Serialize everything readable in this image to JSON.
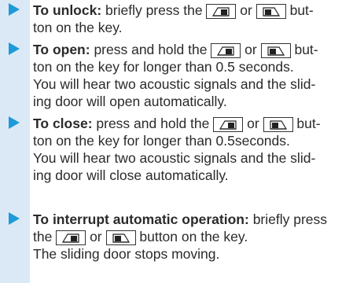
{
  "items": [
    {
      "lead": "To unlock:",
      "l1_a": " briefly press the ",
      "l1_mid": " or ",
      "l1_b": " but-",
      "l2": "ton on the key."
    },
    {
      "lead": "To open:",
      "l1_a": " press and hold the ",
      "l1_mid": " or ",
      "l1_b": " but-",
      "l2": "ton on the key for longer than 0.5 seconds.",
      "l3": "You will hear two acoustic signals and the slid-",
      "l4": "ing door will open automatically."
    },
    {
      "lead": "To close:",
      "l1_a": " press and hold the ",
      "l1_mid": " or ",
      "l1_b": " but-",
      "l2": "ton on the key for longer than 0.5seconds.",
      "l3": "You will hear two acoustic signals and the slid-",
      "l4": "ing door will close automatically."
    },
    {
      "lead": "To interrupt automatic operation:",
      "l1_b": " briefly press",
      "l2_a": "the ",
      "l2_mid": " or ",
      "l2_b": " button on the key.",
      "l3": "The sliding door stops moving."
    }
  ],
  "icons": {
    "left_door_button": "sliding-door-left-key-icon",
    "right_door_button": "sliding-door-right-key-icon"
  },
  "colors": {
    "stripe": "#dbe9f7",
    "bullet": "#1e9ad8",
    "text": "#2a2a2a"
  }
}
